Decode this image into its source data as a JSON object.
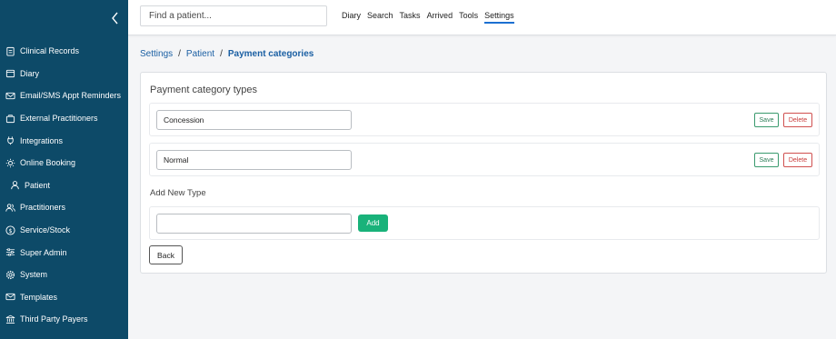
{
  "sidebar": {
    "collapse_icon": "chevron-left-icon",
    "items": [
      {
        "label": "Clinical Records",
        "icon": "clipboard-icon"
      },
      {
        "label": "Diary",
        "icon": "calendar-icon"
      },
      {
        "label": "Email/SMS Appt Reminders",
        "icon": "envelope-icon"
      },
      {
        "label": "External Practitioners",
        "icon": "briefcase-icon"
      },
      {
        "label": "Integrations",
        "icon": "plug-icon"
      },
      {
        "label": "Online Booking",
        "icon": "sun-icon"
      },
      {
        "label": "Patient",
        "icon": "user-icon"
      },
      {
        "label": "Practitioners",
        "icon": "users-icon"
      },
      {
        "label": "Service/Stock",
        "icon": "dollar-icon"
      },
      {
        "label": "Super Admin",
        "icon": "sliders-icon"
      },
      {
        "label": "System",
        "icon": "gear-icon"
      },
      {
        "label": "Templates",
        "icon": "mail-icon"
      },
      {
        "label": "Third Party Payers",
        "icon": "bank-icon"
      }
    ]
  },
  "topbar": {
    "search_placeholder": "Find a patient...",
    "nav": [
      "Diary",
      "Search",
      "Tasks",
      "Arrived",
      "Tools",
      "Settings"
    ],
    "active": "Settings"
  },
  "breadcrumb": {
    "items": [
      "Settings",
      "Patient"
    ],
    "current": "Payment categories",
    "separator": "/"
  },
  "card": {
    "title": "Payment category types",
    "types": [
      {
        "value": "Concession"
      },
      {
        "value": "Normal"
      }
    ],
    "save_label": "Save",
    "delete_label": "Delete",
    "add_title": "Add New Type",
    "add_value": "",
    "add_label": "Add",
    "back_label": "Back"
  },
  "colors": {
    "sidebar_bg": "#0d4a68",
    "link": "#1a5fa3",
    "save": "#2b7d57",
    "delete": "#c93b3a",
    "add_bg": "#19b27a",
    "active_underline": "#1b6fd1"
  }
}
